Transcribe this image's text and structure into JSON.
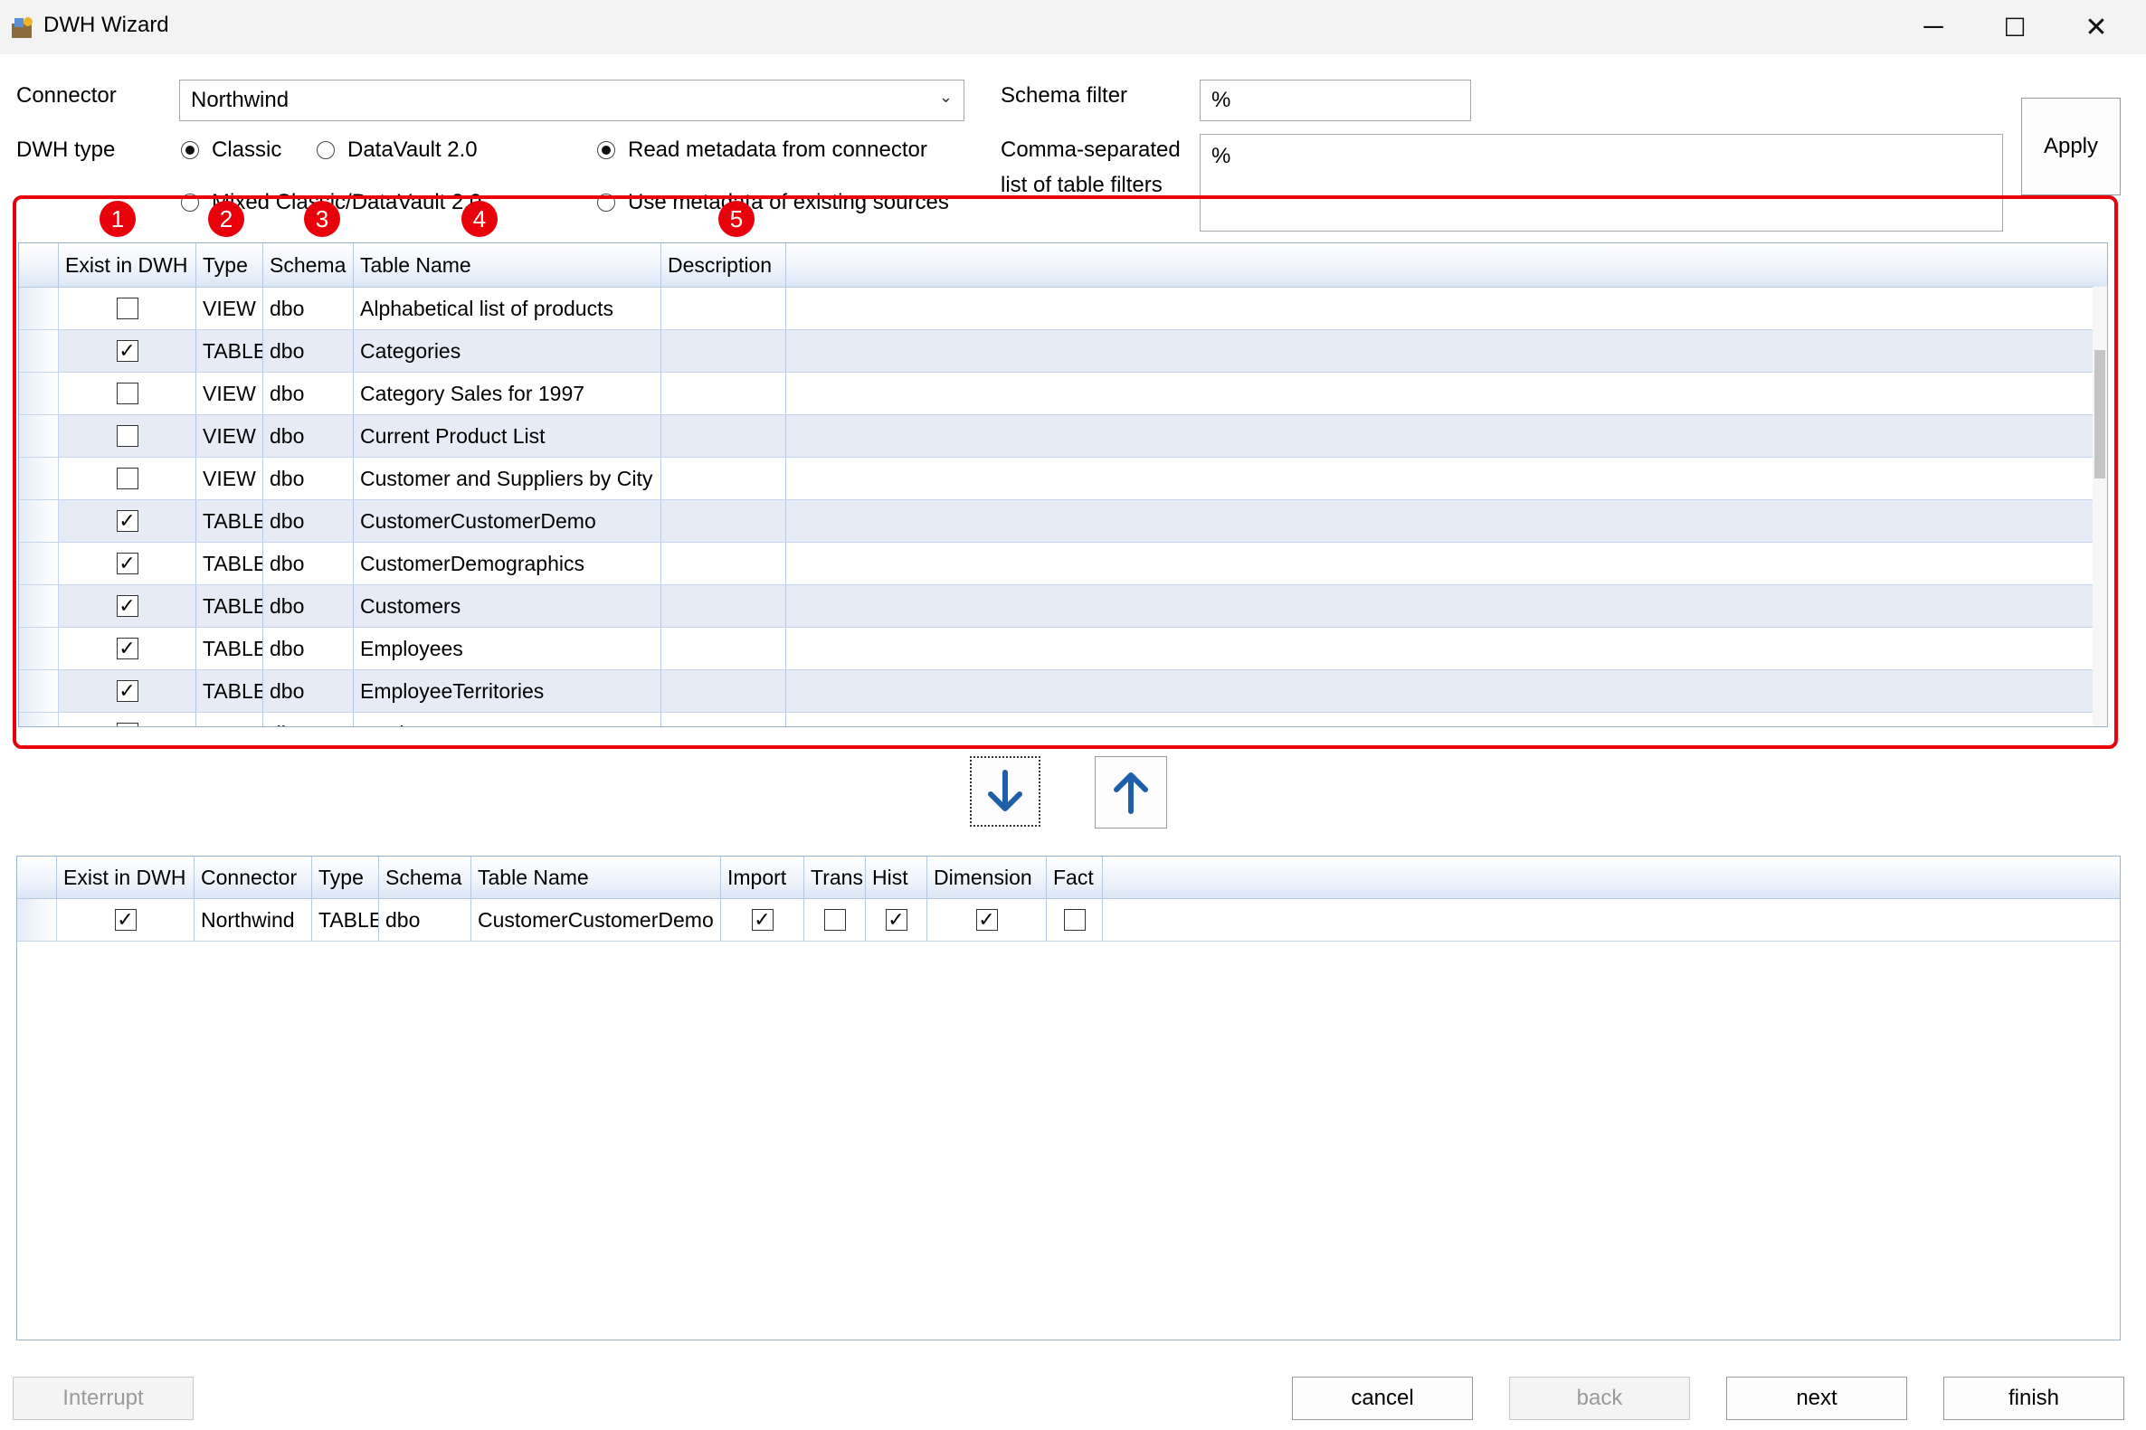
{
  "window": {
    "title": "DWH Wizard",
    "minimize_glyph": "─",
    "maximize_glyph": "☐",
    "close_glyph": "✕"
  },
  "form": {
    "connector_label": "Connector",
    "connector_value": "Northwind",
    "dwh_type_label": "DWH type",
    "radio_classic": "Classic",
    "radio_datavault": "DataVault 2.0",
    "radio_mixed": "Mixed Classic/DataVault 2.0",
    "radio_read_metadata": "Read metadata from connector",
    "radio_use_metadata": "Use metadata of existing sources",
    "schema_filter_label": "Schema filter",
    "schema_filter_value": "%",
    "table_filter_label_1": "Comma-separated",
    "table_filter_label_2": "list of table filters",
    "table_filter_value": "%",
    "apply_label": "Apply",
    "selected_dwh_type": "Classic",
    "selected_metadata_source": "Read metadata from connector"
  },
  "badges": [
    "1",
    "2",
    "3",
    "4",
    "5"
  ],
  "source_grid": {
    "columns": [
      "Exist in DWH",
      "Type",
      "Schema",
      "Table Name",
      "Description"
    ],
    "rows": [
      {
        "exist": false,
        "type": "VIEW",
        "schema": "dbo",
        "name": "Alphabetical list of products",
        "description": ""
      },
      {
        "exist": true,
        "type": "TABLE",
        "schema": "dbo",
        "name": "Categories",
        "description": ""
      },
      {
        "exist": false,
        "type": "VIEW",
        "schema": "dbo",
        "name": "Category Sales for 1997",
        "description": ""
      },
      {
        "exist": false,
        "type": "VIEW",
        "schema": "dbo",
        "name": "Current Product List",
        "description": ""
      },
      {
        "exist": false,
        "type": "VIEW",
        "schema": "dbo",
        "name": "Customer and Suppliers by City",
        "description": ""
      },
      {
        "exist": true,
        "type": "TABLE",
        "schema": "dbo",
        "name": "CustomerCustomerDemo",
        "description": ""
      },
      {
        "exist": true,
        "type": "TABLE",
        "schema": "dbo",
        "name": "CustomerDemographics",
        "description": ""
      },
      {
        "exist": true,
        "type": "TABLE",
        "schema": "dbo",
        "name": "Customers",
        "description": ""
      },
      {
        "exist": true,
        "type": "TABLE",
        "schema": "dbo",
        "name": "Employees",
        "description": ""
      },
      {
        "exist": true,
        "type": "TABLE",
        "schema": "dbo",
        "name": "EmployeeTerritories",
        "description": ""
      },
      {
        "exist": false,
        "type": "VIEW",
        "schema": "dbo",
        "name": "Invoices",
        "description": ""
      }
    ]
  },
  "move_buttons": {
    "down_icon": "arrow-down-icon",
    "up_icon": "arrow-up-icon"
  },
  "selected_grid": {
    "columns": [
      "Exist in DWH",
      "Connector",
      "Type",
      "Schema",
      "Table Name",
      "Import",
      "Trans",
      "Hist",
      "Dimension",
      "Fact"
    ],
    "rows": [
      {
        "exist": true,
        "connector": "Northwind",
        "type": "TABLE",
        "schema": "dbo",
        "name": "CustomerCustomerDemo",
        "import": true,
        "trans": false,
        "hist": true,
        "dimension": true,
        "fact": false
      }
    ]
  },
  "footer": {
    "interrupt": "Interrupt",
    "cancel": "cancel",
    "back": "back",
    "next": "next",
    "finish": "finish"
  },
  "colors": {
    "highlight": "#e8000b",
    "grid_border": "#99b4d1",
    "alt_row": "#e6ebf5",
    "arrow": "#1f5ea8"
  }
}
